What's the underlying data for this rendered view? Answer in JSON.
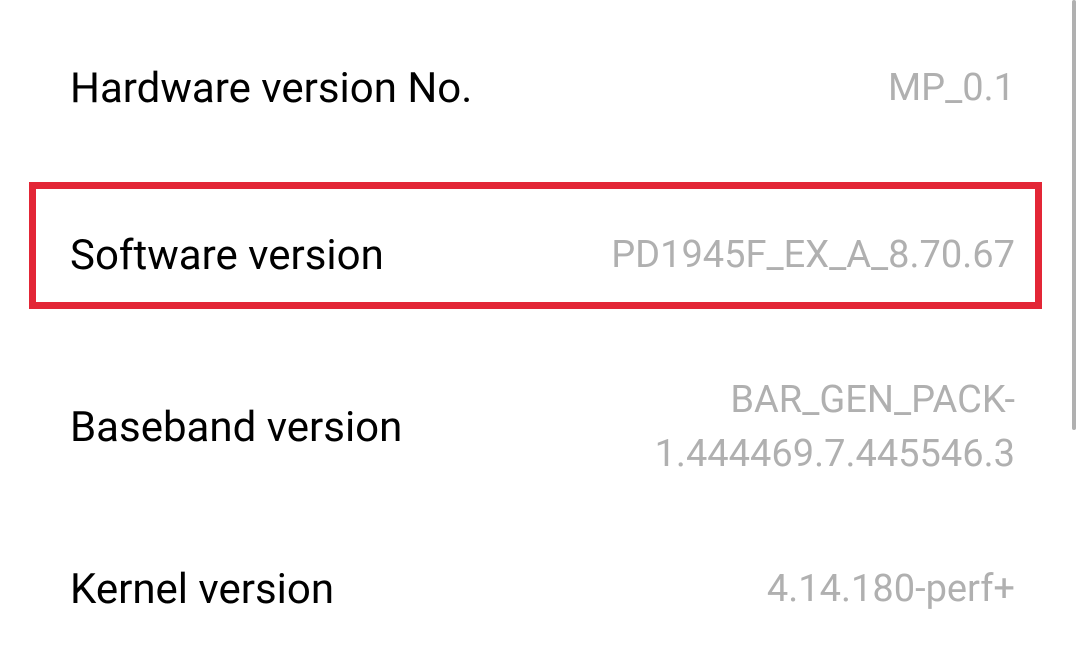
{
  "settings": {
    "hardware": {
      "label": "Hardware version No.",
      "value": "MP_0.1"
    },
    "software": {
      "label": "Software version",
      "value": "PD1945F_EX_A_8.70.67"
    },
    "baseband": {
      "label": "Baseband version",
      "value": "BAR_GEN_PACK-1.444469.7.445546.3"
    },
    "kernel": {
      "label": "Kernel version",
      "value": "4.14.180-perf+"
    }
  },
  "highlight_color": "#e32636"
}
